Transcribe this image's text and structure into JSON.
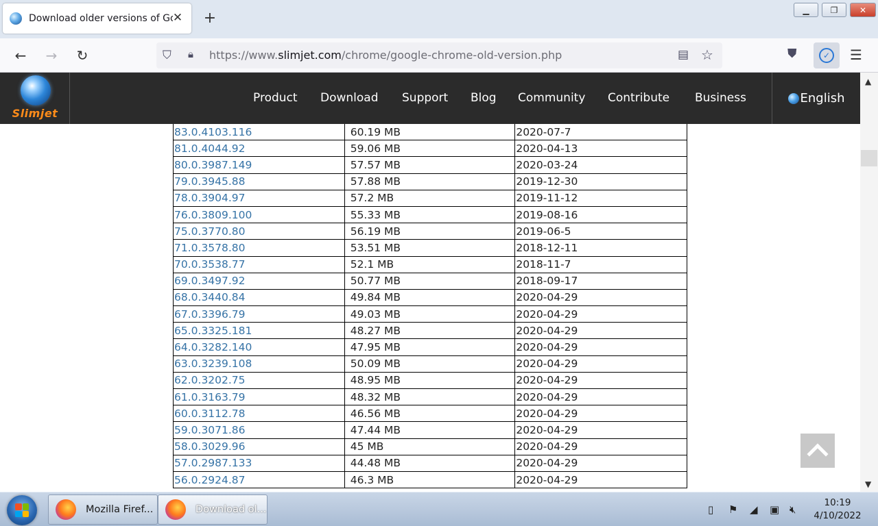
{
  "browser": {
    "tab_title": "Download older versions of Google Chrome",
    "new_tab_label": "+",
    "tab_close_label": "✕",
    "url_prefix": "https://www.",
    "url_domain": "slimjet.com",
    "url_path": "/chrome/google-chrome-old-version.php",
    "window_controls": {
      "minimize": "▁",
      "maximize": "❐",
      "close": "✕"
    }
  },
  "site": {
    "logo_text": "Slimjet",
    "nav": [
      "Product",
      "Download",
      "Support",
      "Blog",
      "Community",
      "Contribute",
      "Business"
    ],
    "language": "English"
  },
  "versions": [
    {
      "version": "83.0.4103.116",
      "size": "60.19 MB",
      "date": "2020-07-7"
    },
    {
      "version": "81.0.4044.92",
      "size": "59.06 MB",
      "date": "2020-04-13"
    },
    {
      "version": "80.0.3987.149",
      "size": "57.57 MB",
      "date": "2020-03-24"
    },
    {
      "version": "79.0.3945.88",
      "size": "57.88 MB",
      "date": "2019-12-30"
    },
    {
      "version": "78.0.3904.97",
      "size": "57.2 MB",
      "date": "2019-11-12"
    },
    {
      "version": "76.0.3809.100",
      "size": "55.33 MB",
      "date": "2019-08-16"
    },
    {
      "version": "75.0.3770.80",
      "size": "56.19 MB",
      "date": "2019-06-5"
    },
    {
      "version": "71.0.3578.80",
      "size": "53.51 MB",
      "date": "2018-12-11"
    },
    {
      "version": "70.0.3538.77",
      "size": "52.1 MB",
      "date": "2018-11-7"
    },
    {
      "version": "69.0.3497.92",
      "size": "50.77 MB",
      "date": "2018-09-17"
    },
    {
      "version": "68.0.3440.84",
      "size": "49.84 MB",
      "date": "2020-04-29"
    },
    {
      "version": "67.0.3396.79",
      "size": "49.03 MB",
      "date": "2020-04-29"
    },
    {
      "version": "65.0.3325.181",
      "size": "48.27 MB",
      "date": "2020-04-29"
    },
    {
      "version": "64.0.3282.140",
      "size": "47.95 MB",
      "date": "2020-04-29"
    },
    {
      "version": "63.0.3239.108",
      "size": "50.09 MB",
      "date": "2020-04-29"
    },
    {
      "version": "62.0.3202.75",
      "size": "48.95 MB",
      "date": "2020-04-29"
    },
    {
      "version": "61.0.3163.79",
      "size": "48.32 MB",
      "date": "2020-04-29"
    },
    {
      "version": "60.0.3112.78",
      "size": "46.56 MB",
      "date": "2020-04-29"
    },
    {
      "version": "59.0.3071.86",
      "size": "47.44 MB",
      "date": "2020-04-29"
    },
    {
      "version": "58.0.3029.96",
      "size": "45 MB",
      "date": "2020-04-29"
    },
    {
      "version": "57.0.2987.133",
      "size": "44.48 MB",
      "date": "2020-04-29"
    },
    {
      "version": "56.0.2924.87",
      "size": "46.3 MB",
      "date": "2020-04-29"
    }
  ],
  "taskbar": {
    "items": [
      {
        "label": "Mozilla Firef..."
      },
      {
        "label": "Download ol..."
      }
    ],
    "time": "10:19",
    "date": "4/10/2022"
  },
  "colors": {
    "site_header": "#2b2b2b",
    "link": "#3673a6",
    "logo_orange": "#ff8c1a"
  }
}
